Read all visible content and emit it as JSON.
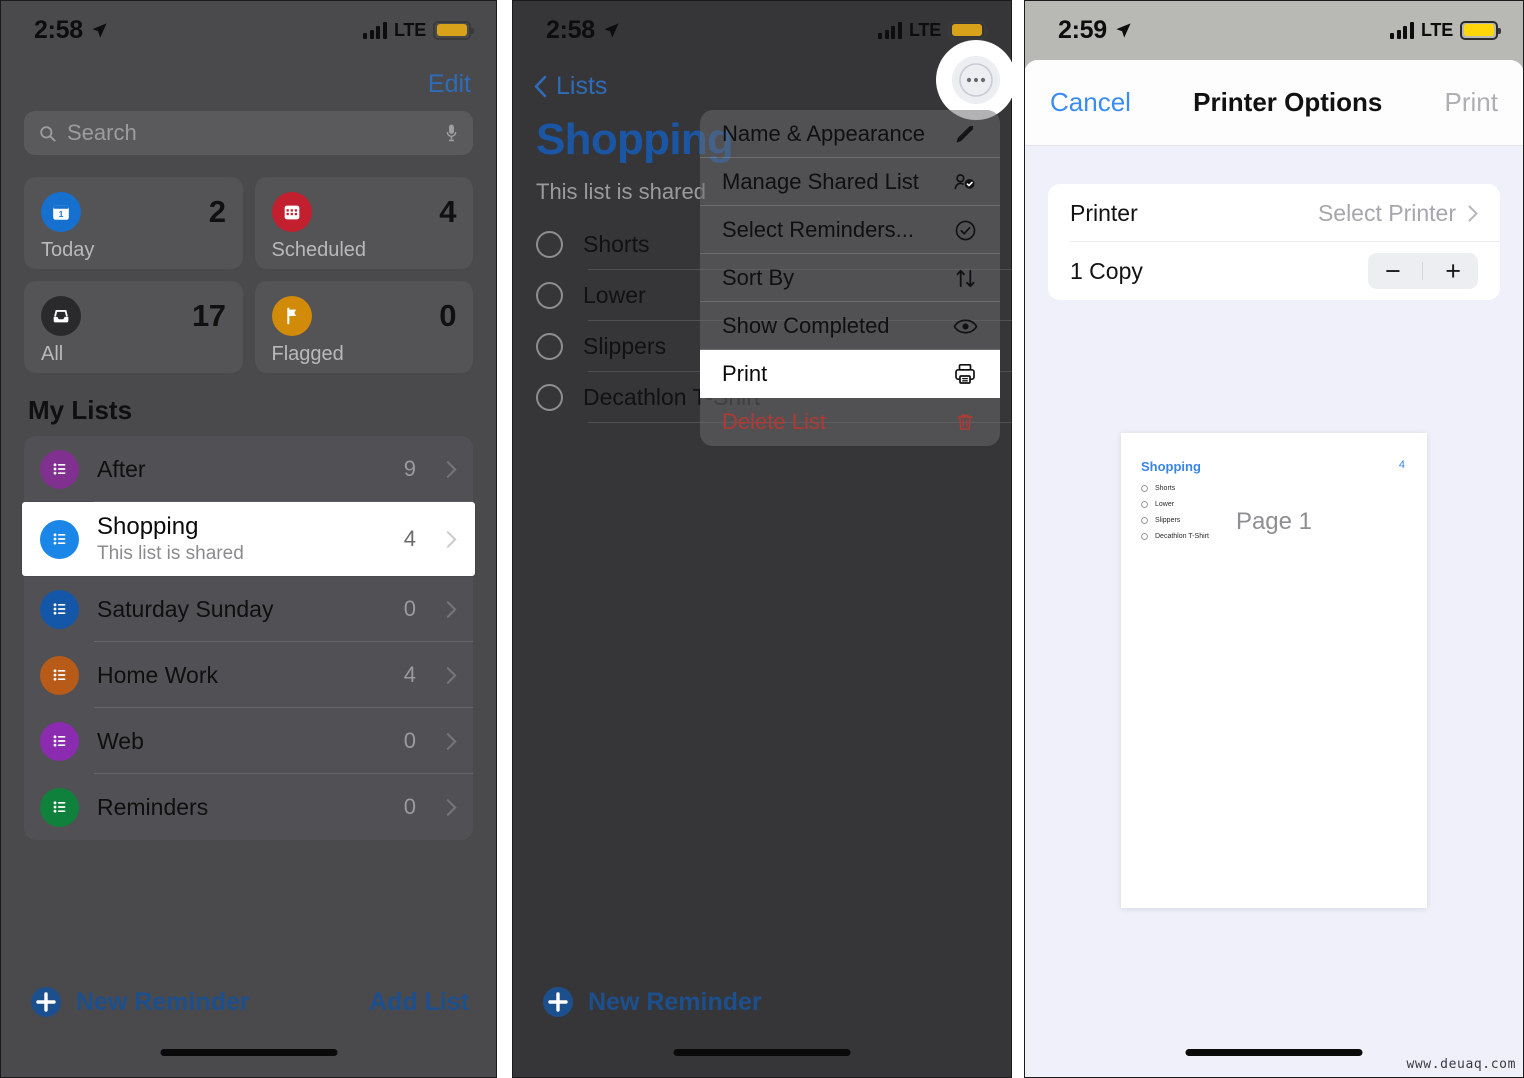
{
  "panel1": {
    "status": {
      "time": "2:58",
      "carrier": "LTE",
      "location_icon": "location-arrow-icon",
      "battery_icon": "battery-icon"
    },
    "edit_label": "Edit",
    "search": {
      "placeholder": "Search",
      "icon": "search-icon",
      "mic_icon": "microphone-icon"
    },
    "smart_lists": [
      {
        "label": "Today",
        "count": "2",
        "icon": "today-calendar-icon",
        "color": "#1570cf"
      },
      {
        "label": "Scheduled",
        "count": "4",
        "icon": "scheduled-calendar-icon",
        "color": "#c2202e"
      },
      {
        "label": "All",
        "count": "17",
        "icon": "all-inbox-icon",
        "color": "#2a2a2d"
      },
      {
        "label": "Flagged",
        "count": "0",
        "icon": "flag-icon",
        "color": "#d28a09"
      }
    ],
    "my_lists_header": "My Lists",
    "lists": [
      {
        "name": "After",
        "subtitle": "",
        "count": "9",
        "color": "#80308f",
        "selected": false
      },
      {
        "name": "Shopping",
        "subtitle": "This list is shared",
        "count": "4",
        "color": "#1a86e8",
        "selected": true
      },
      {
        "name": "Saturday Sunday",
        "subtitle": "",
        "count": "0",
        "color": "#1457a8",
        "selected": false
      },
      {
        "name": "Home Work",
        "subtitle": "",
        "count": "4",
        "color": "#b85a18",
        "selected": false
      },
      {
        "name": "Web",
        "subtitle": "",
        "count": "0",
        "color": "#8a2bb0",
        "selected": false
      },
      {
        "name": "Reminders",
        "subtitle": "",
        "count": "0",
        "color": "#10803d",
        "selected": false
      }
    ],
    "new_reminder_label": "New Reminder",
    "add_list_label": "Add List"
  },
  "panel2": {
    "status": {
      "time": "2:58",
      "carrier": "LTE"
    },
    "back_label": "Lists",
    "title": "Shopping",
    "shared_note": "This list is shared",
    "reminders": [
      "Shorts",
      "Lower",
      "Slippers",
      "Decathlon T-Shirt"
    ],
    "more_button_icon": "ellipsis-circle-icon",
    "menu": [
      {
        "label": "Name & Appearance",
        "icon": "pencil-icon",
        "selected": false,
        "danger": false
      },
      {
        "label": "Manage Shared List",
        "icon": "person-badge-icon",
        "selected": false,
        "danger": false
      },
      {
        "label": "Select Reminders...",
        "icon": "checkmark-circle-icon",
        "selected": false,
        "danger": false
      },
      {
        "label": "Sort By",
        "icon": "arrow-up-arrow-down-icon",
        "selected": false,
        "danger": false
      },
      {
        "label": "Show Completed",
        "icon": "eye-icon",
        "selected": false,
        "danger": false
      },
      {
        "label": "Print",
        "icon": "printer-icon",
        "selected": true,
        "danger": false
      },
      {
        "label": "Delete List",
        "icon": "trash-icon",
        "selected": false,
        "danger": true
      }
    ],
    "new_reminder_label": "New Reminder"
  },
  "panel3": {
    "status": {
      "time": "2:59",
      "carrier": "LTE"
    },
    "cancel_label": "Cancel",
    "title": "Printer Options",
    "print_label": "Print",
    "options": [
      {
        "label": "Printer",
        "value": "Select Printer",
        "chevron": true
      },
      {
        "label": "1 Copy",
        "value": "",
        "chevron": false
      }
    ],
    "stepper": {
      "minus": "−",
      "plus": "+"
    },
    "preview": {
      "title": "Shopping",
      "count": "4",
      "items": [
        "Shorts",
        "Lower",
        "Slippers",
        "Decathlon T-Shirt"
      ],
      "footer_left": "",
      "footer_right": ""
    },
    "page_label": "Page 1"
  },
  "watermark": "www.deuaq.com",
  "colors": {
    "ios_blue": "#3a8cf0",
    "dim_overlay": "#4a4a4d",
    "highlight_white": "#ffffff"
  }
}
